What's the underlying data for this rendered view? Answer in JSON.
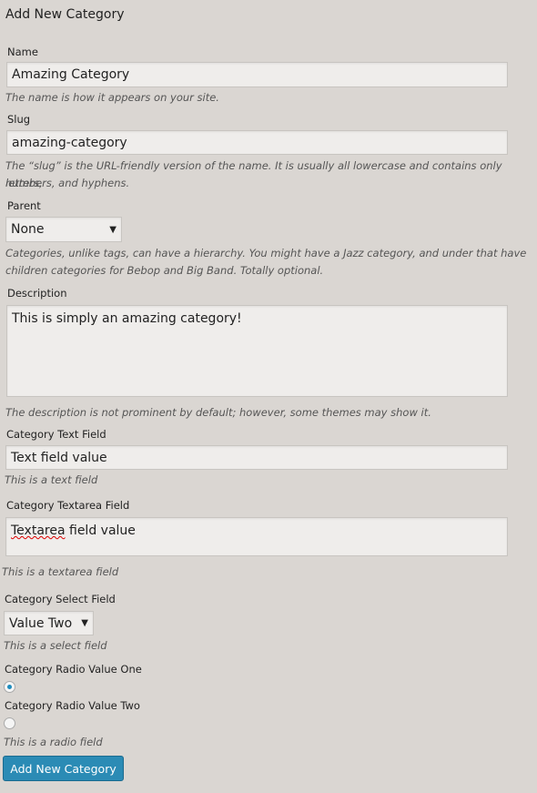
{
  "title": "Add New Category",
  "name": {
    "label": "Name",
    "value": "Amazing Category",
    "help": "The name is how it appears on your site."
  },
  "slug": {
    "label": "Slug",
    "value": "amazing-category",
    "help1": "The “slug” is the URL-friendly version of the name. It is usually all lowercase and contains only letters,",
    "help2": "numbers, and hyphens."
  },
  "parent": {
    "label": "Parent",
    "value": "None",
    "help1": "Categories, unlike tags, can have a hierarchy. You might have a Jazz category, and under that have",
    "help2": "children categories for Bebop and Big Band. Totally optional."
  },
  "description": {
    "label": "Description",
    "value": "This is simply an amazing category!",
    "help": "The description is not prominent by default; however, some themes may show it."
  },
  "text_field": {
    "label": "Category Text Field",
    "value": "Text field value",
    "help": "This is a text field"
  },
  "textarea_field": {
    "label": "Category Textarea Field",
    "value_word": "Textarea",
    "value_rest": " field value",
    "help": "This is a textarea field"
  },
  "select_field": {
    "label": "Category Select Field",
    "value": "Value Two",
    "help": "This is a select field"
  },
  "radio": {
    "option1": "Category Radio Value One",
    "option2": "Category Radio Value Two",
    "selected": "option1",
    "help": "This is a radio field"
  },
  "submit": "Add New Category"
}
